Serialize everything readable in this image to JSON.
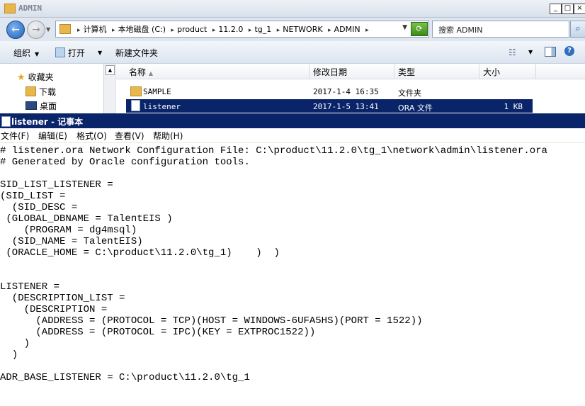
{
  "explorer": {
    "title": "ADMIN",
    "breadcrumb": [
      "计算机",
      "本地磁盘 (C:)",
      "product",
      "11.2.0",
      "tg_1",
      "NETWORK",
      "ADMIN"
    ],
    "search_placeholder": "搜索 ADMIN",
    "toolbar": {
      "organize": "组织",
      "open": "打开",
      "new_folder": "新建文件夹"
    },
    "nav": {
      "favorites": "收藏夹",
      "downloads": "下载",
      "desktop": "桌面"
    },
    "columns": {
      "name": "名称",
      "modified": "修改日期",
      "type": "类型",
      "size": "大小"
    },
    "files": [
      {
        "name": "SAMPLE",
        "modified": "2017-1-4 16:35",
        "type": "文件夹",
        "size": ""
      },
      {
        "name": "listener",
        "modified": "2017-1-5 13:41",
        "type": "ORA 文件",
        "size": "1 KB"
      }
    ]
  },
  "notepad": {
    "title": "listener - 记事本",
    "menu": [
      "文件(F)",
      "编辑(E)",
      "格式(O)",
      "查看(V)",
      "帮助(H)"
    ],
    "content": "# listener.ora Network Configuration File: C:\\product\\11.2.0\\tg_1\\network\\admin\\listener.ora\n# Generated by Oracle configuration tools.\n\nSID_LIST_LISTENER =\n(SID_LIST =\n  (SID_DESC =\n (GLOBAL_DBNAME = TalentEIS )\n    (PROGRAM = dg4msql)\n  (SID_NAME = TalentEIS)\n (ORACLE_HOME = C:\\product\\11.2.0\\tg_1)    )  )\n\n\nLISTENER =\n  (DESCRIPTION_LIST =\n    (DESCRIPTION =\n      (ADDRESS = (PROTOCOL = TCP)(HOST = WINDOWS-6UFA5HS)(PORT = 1522))\n      (ADDRESS = (PROTOCOL = IPC)(KEY = EXTPROC1522))\n    )\n  )\n\nADR_BASE_LISTENER = C:\\product\\11.2.0\\tg_1"
  }
}
